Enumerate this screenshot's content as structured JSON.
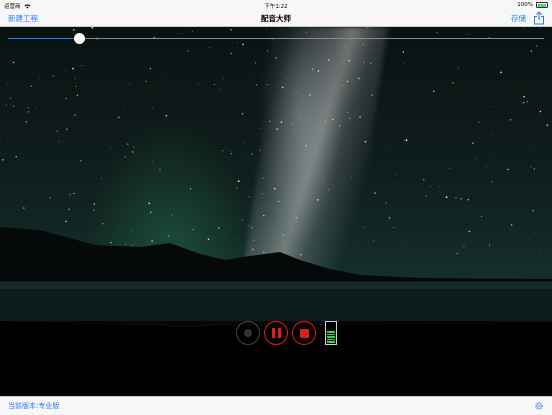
{
  "status_bar": {
    "carrier": "运营商",
    "time": "下午1:22",
    "battery": "100%"
  },
  "nav": {
    "new_project": "新建工程",
    "title": "配音大师",
    "save": "存储"
  },
  "icons": {
    "wifi": "wifi-icon",
    "battery": "battery-icon",
    "share": "share-icon",
    "record": "record-icon",
    "pause": "pause-icon",
    "stop": "stop-icon",
    "level_meter": "level-meter-icon",
    "settings": "gear-icon"
  },
  "playback": {
    "progress": 0.133
  },
  "level_meter": {
    "lit_segments": 5,
    "total_segments": 8
  },
  "footer": {
    "version": "当前版本:专业版"
  },
  "colors": {
    "accent": "#2d7cf6",
    "record_active": "#e31b1b",
    "level": "#2fd24a"
  }
}
